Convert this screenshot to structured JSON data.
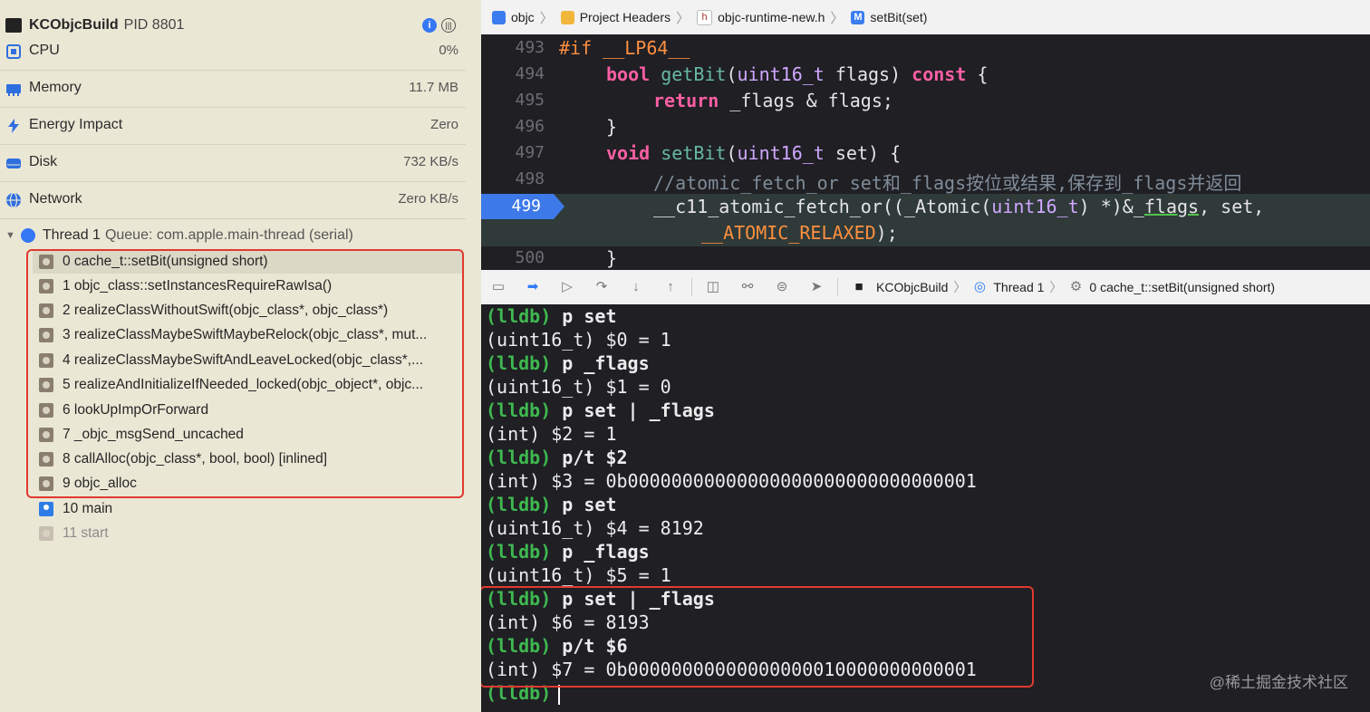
{
  "process": {
    "name": "KCObjcBuild",
    "pid": "PID 8801"
  },
  "gauges": [
    {
      "label": "CPU",
      "value": "0%",
      "icon": "cpu-icon"
    },
    {
      "label": "Memory",
      "value": "11.7 MB",
      "icon": "memory-icon"
    },
    {
      "label": "Energy Impact",
      "value": "Zero",
      "icon": "energy-icon"
    },
    {
      "label": "Disk",
      "value": "732 KB/s",
      "icon": "disk-icon"
    },
    {
      "label": "Network",
      "value": "Zero KB/s",
      "icon": "network-icon"
    }
  ],
  "thread": {
    "name": "Thread 1",
    "queue": "Queue: com.apple.main-thread (serial)"
  },
  "frames": [
    "0 cache_t::setBit(unsigned short)",
    "1 objc_class::setInstancesRequireRawIsa()",
    "2 realizeClassWithoutSwift(objc_class*, objc_class*)",
    "3 realizeClassMaybeSwiftMaybeRelock(objc_class*, mut...",
    "4 realizeClassMaybeSwiftAndLeaveLocked(objc_class*,...",
    "5 realizeAndInitializeIfNeeded_locked(objc_object*, objc...",
    "6 lookUpImpOrForward",
    "7 _objc_msgSend_uncached",
    "8 callAlloc(objc_class*, bool, bool) [inlined]",
    "9 objc_alloc",
    "10 main",
    "11 start"
  ],
  "breadcrumb": [
    "objc",
    "Project Headers",
    "objc-runtime-new.h",
    "setBit(set)"
  ],
  "code": {
    "line_numbers": [
      "493",
      "494",
      "495",
      "496",
      "497",
      "498",
      "499",
      "500"
    ],
    "l493": {
      "a": "#if ",
      "b": "__LP64__"
    },
    "l494": {
      "a": "bool",
      "b": "getBit",
      "c": "(",
      "d": "uint16_t",
      "e": " flags) ",
      "f": "const",
      "g": " {"
    },
    "l495": {
      "a": "return",
      "b": " _flags & flags;"
    },
    "l496": "}",
    "l497": {
      "a": "void",
      "b": "setBit",
      "c": "(",
      "d": "uint16_t",
      "e": " set) {"
    },
    "l498": "//atomic_fetch_or set和_flags按位或结果,保存到_flags并返回",
    "l499": {
      "a": "__c11_atomic_fetch_or((_Atomic(",
      "b": "uint16_t",
      "c": ") *)&_",
      "d": "flags",
      "e": ", set,"
    },
    "l499b": {
      "a": "__ATOMIC_RELAXED",
      "b": ");"
    },
    "l500": "}"
  },
  "debug_bar": {
    "target": "KCObjcBuild",
    "thread": "Thread 1",
    "frame": "0 cache_t::setBit(unsigned short)"
  },
  "console": [
    {
      "type": "cmd",
      "prompt": "(lldb)",
      "text": " p set"
    },
    {
      "type": "out",
      "text": "(uint16_t) $0 = 1"
    },
    {
      "type": "cmd",
      "prompt": "(lldb)",
      "text": " p _flags"
    },
    {
      "type": "out",
      "text": "(uint16_t) $1 = 0"
    },
    {
      "type": "cmd",
      "prompt": "(lldb)",
      "text": " p set | _flags"
    },
    {
      "type": "out",
      "text": "(int) $2 = 1"
    },
    {
      "type": "cmd",
      "prompt": "(lldb)",
      "text": " p/t $2"
    },
    {
      "type": "out",
      "text": "(int) $3 = 0b00000000000000000000000000000001"
    },
    {
      "type": "cmd",
      "prompt": "(lldb)",
      "text": " p set"
    },
    {
      "type": "out",
      "text": "(uint16_t) $4 = 8192"
    },
    {
      "type": "cmd",
      "prompt": "(lldb)",
      "text": " p _flags"
    },
    {
      "type": "out",
      "text": "(uint16_t) $5 = 1"
    },
    {
      "type": "cmd",
      "prompt": "(lldb)",
      "text": " p set | _flags"
    },
    {
      "type": "out",
      "text": "(int) $6 = 8193"
    },
    {
      "type": "cmd",
      "prompt": "(lldb)",
      "text": " p/t $6"
    },
    {
      "type": "out",
      "text": "(int) $7 = 0b00000000000000000010000000000001"
    },
    {
      "type": "cmd",
      "prompt": "(lldb)",
      "text": ""
    }
  ],
  "watermark": "@稀土掘金技术社区"
}
